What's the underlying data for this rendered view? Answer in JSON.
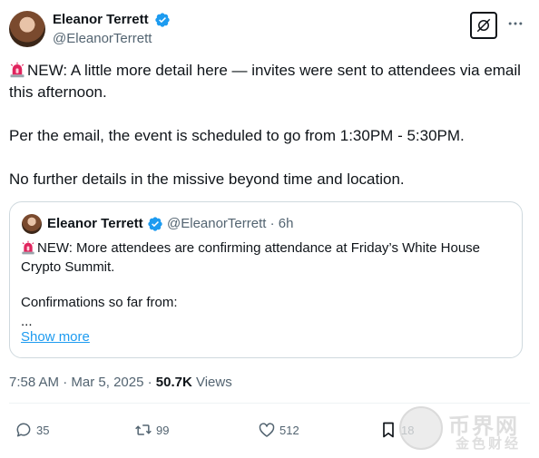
{
  "author": {
    "name": "Eleanor Terrett",
    "handle": "@EleanorTerrett",
    "verified_color": "#1d9bf0"
  },
  "header_icons": {
    "grok": "grok-icon",
    "more": "more-icon"
  },
  "post": {
    "line1_emoji": "siren-emoji",
    "paragraph1": "NEW: A little more detail here — invites were sent to attendees via email this afternoon.",
    "paragraph2": "Per the email, the event is scheduled to go from 1:30PM - 5:30PM.",
    "paragraph3": "No further details in the missive beyond time and location."
  },
  "quoted": {
    "name": "Eleanor Terrett",
    "handle_time": "@EleanorTerrett · 6h",
    "text1": "NEW: More attendees are confirming attendance at Friday’s White House Crypto Summit.",
    "text2": "Confirmations so far from:",
    "text3": "...",
    "show_more": "Show more"
  },
  "meta": {
    "time": "7:58 AM",
    "separator": " · ",
    "date": "Mar 5, 2025",
    "views_count": "50.7K",
    "views_label": " Views"
  },
  "actions": {
    "reply_count": "35",
    "repost_count": "99",
    "like_count": "512",
    "bookmark_count": "18"
  },
  "watermark": {
    "top": "币界网",
    "bottom": "金色财经"
  },
  "colors": {
    "text": "#0f1419",
    "secondary": "#536471",
    "link": "#1d9bf0",
    "border": "#cfd9de"
  }
}
